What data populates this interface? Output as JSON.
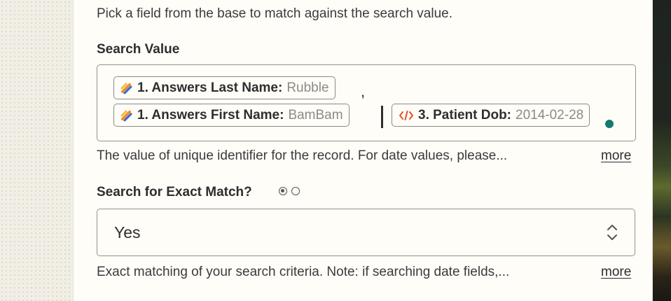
{
  "intro_text": "Pick a field from the base to match against the search value.",
  "search_value": {
    "label": "Search Value",
    "tokens": [
      {
        "icon": "form-app-icon",
        "key": "1. Answers Last Name:",
        "value": "Rubble"
      },
      {
        "icon": "form-app-icon",
        "key": "1. Answers First Name:",
        "value": "BamBam"
      },
      {
        "icon": "code-icon",
        "key": "3. Patient Dob:",
        "value": "2014-02-28"
      }
    ],
    "separator": ",",
    "description": "The value of unique identifier for the record. For date values, please...",
    "more_label": "more"
  },
  "exact_match": {
    "label": "Search for Exact Match?",
    "selected_value": "Yes",
    "description": "Exact matching of your search criteria. Note: if searching date fields,...",
    "more_label": "more"
  },
  "colors": {
    "accent_teal": "#137a6e",
    "code_icon": "#e0512b",
    "form_icon_orange": "#f28a2e",
    "form_icon_blue": "#2f6fdb",
    "text": "#2d2e2e",
    "muted": "#8b8b86"
  }
}
